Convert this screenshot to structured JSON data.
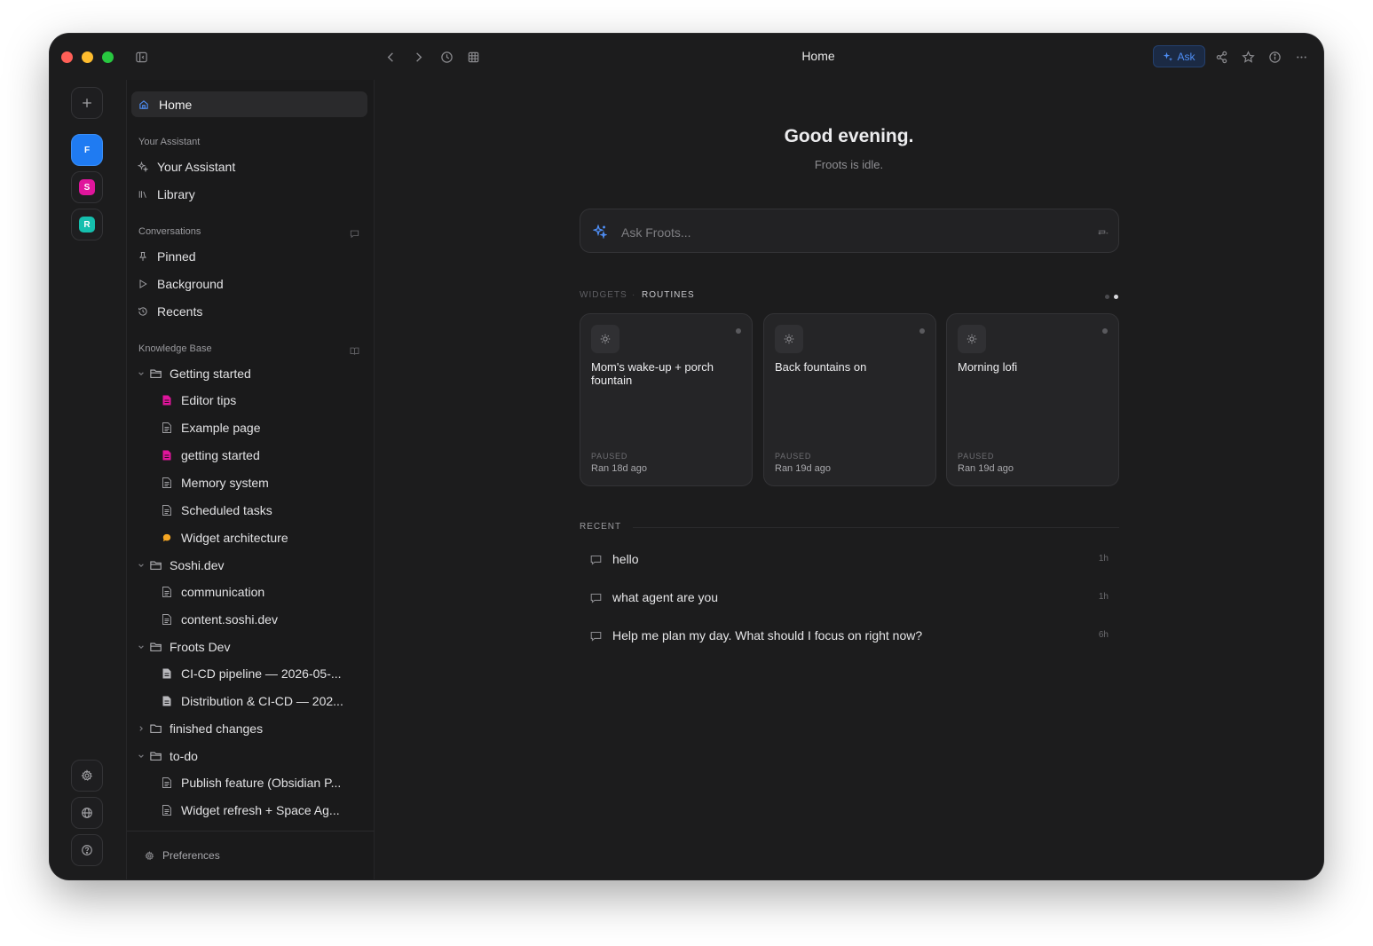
{
  "window": {
    "title": "Home"
  },
  "toolbar": {
    "ask_label": "Ask"
  },
  "workspaces": [
    {
      "letter": "F",
      "color": "#1f7bf2"
    },
    {
      "letter": "S",
      "color": "#e0159c"
    },
    {
      "letter": "R",
      "color": "#15bfae"
    }
  ],
  "sidebar": {
    "home_label": "Home",
    "assistant_section": "Your Assistant",
    "assistant_items": [
      "Your Assistant",
      "Library"
    ],
    "conversations_section": "Conversations",
    "conversation_items": [
      "Pinned",
      "Background",
      "Recents"
    ],
    "kb_section": "Knowledge Base",
    "tree": {
      "getting_started": {
        "label": "Getting started",
        "docs": [
          "Editor tips",
          "Example page",
          "getting started",
          "Memory system",
          "Scheduled tasks",
          "Widget architecture"
        ]
      },
      "soshi": {
        "label": "Soshi.dev",
        "docs": [
          "communication",
          "content.soshi.dev"
        ]
      },
      "froots_dev": {
        "label": "Froots Dev",
        "docs": [
          "CI-CD pipeline — 2026-05-...",
          "Distribution & CI-CD — 202..."
        ]
      },
      "finished": {
        "label": "finished changes"
      },
      "todo": {
        "label": "to-do",
        "docs": [
          "Publish feature (Obsidian P...",
          "Widget refresh + Space Ag..."
        ]
      }
    },
    "preferences_label": "Preferences"
  },
  "main": {
    "greeting": "Good evening.",
    "status": "Froots is idle.",
    "ask_placeholder": "Ask Froots...",
    "tabs": {
      "widgets": "WIDGETS",
      "routines": "ROUTINES"
    },
    "routines": [
      {
        "title": "Mom's wake-up + porch fountain",
        "state": "PAUSED",
        "ran": "Ran 18d ago"
      },
      {
        "title": "Back fountains on",
        "state": "PAUSED",
        "ran": "Ran 19d ago"
      },
      {
        "title": "Morning lofi",
        "state": "PAUSED",
        "ran": "Ran 19d ago"
      }
    ],
    "recent_label": "RECENT",
    "recent": [
      {
        "text": "hello",
        "time": "1h"
      },
      {
        "text": "what agent are you",
        "time": "1h"
      },
      {
        "text": "Help me plan my day. What should I focus on right now?",
        "time": "6h"
      }
    ]
  },
  "colors": {
    "accent": "#4f8ff7",
    "pink_doc": "#e0159c",
    "orange_doc": "#f5a623"
  }
}
